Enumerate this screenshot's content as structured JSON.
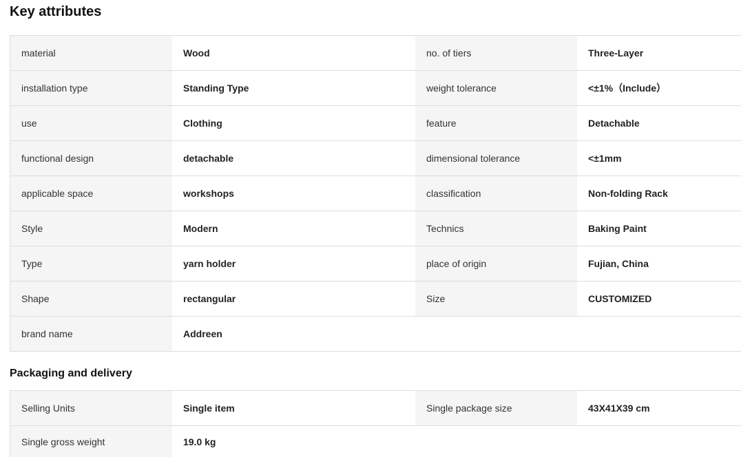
{
  "key_attributes": {
    "title": "Key attributes",
    "rows": [
      {
        "label1": "material",
        "value1": "Wood",
        "label2": "no. of tiers",
        "value2": "Three-Layer"
      },
      {
        "label1": "installation type",
        "value1": "Standing Type",
        "label2": "weight tolerance",
        "value2": "<±1%（Include）"
      },
      {
        "label1": "use",
        "value1": "Clothing",
        "label2": "feature",
        "value2": "Detachable"
      },
      {
        "label1": "functional design",
        "value1": "detachable",
        "label2": "dimensional tolerance",
        "value2": "<±1mm"
      },
      {
        "label1": "applicable space",
        "value1": "workshops",
        "label2": "classification",
        "value2": "Non-folding Rack"
      },
      {
        "label1": "Style",
        "value1": "Modern",
        "label2": "Technics",
        "value2": "Baking Paint"
      },
      {
        "label1": "Type",
        "value1": "yarn holder",
        "label2": "place of origin",
        "value2": "Fujian, China"
      },
      {
        "label1": "Shape",
        "value1": "rectangular",
        "label2": "Size",
        "value2": "CUSTOMIZED"
      },
      {
        "label1": "brand name",
        "value1": "Addreen",
        "label2": "",
        "value2": ""
      }
    ]
  },
  "packaging": {
    "title": "Packaging and delivery",
    "rows": [
      {
        "label1": "Selling Units",
        "value1": "Single item",
        "label2": "Single package size",
        "value2": "43X41X39 cm"
      },
      {
        "label1": "Single gross weight",
        "value1": "19.0 kg",
        "label2": "",
        "value2": ""
      }
    ]
  }
}
